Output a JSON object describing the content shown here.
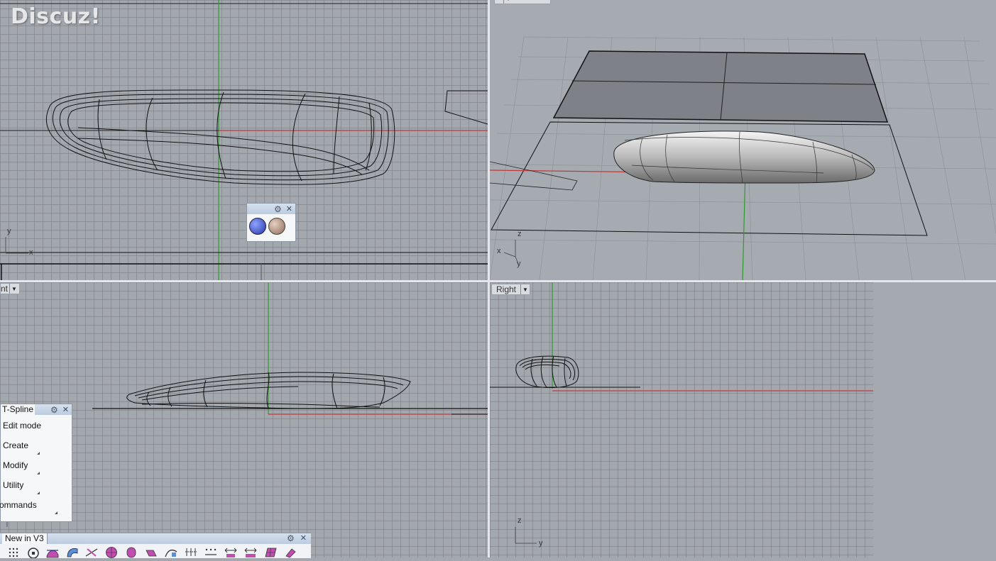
{
  "watermark": "Discuz!",
  "viewports": {
    "top": {
      "axis_y": "y",
      "axis_x": "x"
    },
    "perspective": {
      "axis_z": "z",
      "axis_x": "x",
      "axis_y": "y"
    },
    "front": {
      "tab_label": "nt"
    },
    "right": {
      "tab_label": "Right",
      "axis_z": "z",
      "axis_y": "y"
    }
  },
  "tsplines_panel": {
    "title": "T-Spline",
    "items": [
      "Edit mode",
      "Create",
      "Modify",
      "Utility",
      "ommands"
    ]
  },
  "v3_toolbar": {
    "title": "New in V3"
  },
  "colors": {
    "x_axis": "#c03a3a",
    "y_axis": "#2e9a2e",
    "viewport_bg": "#a3a8af"
  }
}
